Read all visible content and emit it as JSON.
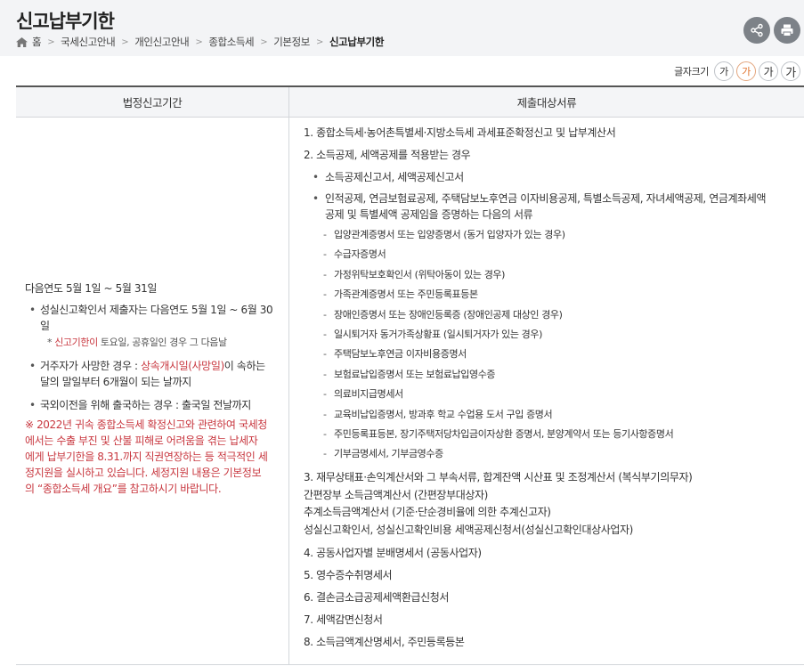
{
  "header": {
    "title": "신고납부기한",
    "breadcrumb": [
      "홈",
      "국세신고안내",
      "개인신고안내",
      "종합소득세",
      "기본정보",
      "신고납부기한"
    ]
  },
  "font_size": {
    "label": "글자크기",
    "options": [
      "가",
      "가",
      "가",
      "가"
    ]
  },
  "table": {
    "headers": [
      "법정신고기간",
      "제출대상서류"
    ],
    "left": {
      "period": "다음연도 5월 1일 ~ 5월 31일",
      "b1_line1": "성실신고확인서 제출자는 다음연도 5월 1일 ~ 6월 30",
      "b1_line2": "일",
      "note_prefix": "* ",
      "note_red": "신고기한이",
      "note_rest": " 토요일, 공휴일인 경우 그 다음날",
      "b2_pre": "거주자가 사망한 경우 : ",
      "b2_red": "상속개시일(사망일)",
      "b2_post_line1": "이 속하는",
      "b2_line2": "달의 말일부터 6개월이 되는 날까지",
      "b3": "국외이전을 위해 출국하는 경우 : 출국일 전날까지",
      "notice": [
        "※ 2022년 귀속 종합소득세 확정신고와 관련하여 국세청",
        "에서는 수출 부진 및 산불 피해로 어려움을 겪는 납세자",
        "에게 납부기한을 8.31.까지 직권연장하는 등 적극적인 세",
        "정지원을 실시하고 있습니다. 세정지원 내용은 기본정보",
        "의 “종합소득세 개요”를 참고하시기 바랍니다."
      ]
    },
    "right": {
      "item1": "1. 종합소득세·농어촌특별세·지방소득세 과세표준확정신고 및 납부계산서",
      "item2": "2. 소득공제, 세액공제를 적용받는 경우",
      "item2_b1": "소득공제신고서, 세액공제신고서",
      "item2_b2_line1": "인적공제, 연금보험료공제, 주택담보노후연금 이자비용공제, 특별소득공제, 자녀세액공제, 연금계좌세액",
      "item2_b2_line2": "공제 및 특별세액 공제임을 증명하는 다음의 서류",
      "dashes": [
        "입양관계증명서 또는 입양증명서 (동거 입양자가 있는 경우)",
        "수급자증명서",
        "가정위탁보호확인서 (위탁아동이 있는 경우)",
        "가족관계증명서 또는 주민등록표등본",
        "장애인증명서 또는 장애인등록증 (장애인공제 대상인 경우)",
        "일시퇴거자 동거가족상황표 (일시퇴거자가 있는 경우)",
        "주택담보노후연금 이자비용증명서",
        "보험료납입증명서 또는 보험료납입영수증",
        "의료비지급명세서",
        "교육비납입증명서, 방과후 학교 수업용 도서 구입 증명서",
        "주민등록표등본, 장기주택저당차입금이자상환 증명서, 분양계약서 또는 등기사항증명서",
        "기부금명세서, 기부금영수증"
      ],
      "item3": [
        "3. 재무상태표·손익계산서와 그 부속서류, 합계잔액 시산표 및 조정계산서 (복식부기의무자)",
        "간편장부 소득금액계산서 (간편장부대상자)",
        "추계소득금액계산서 (기준·단순경비율에 의한 추계신고자)",
        "성실신고확인서, 성실신고확인비용 세액공제신청서(성실신고확인대상사업자)"
      ],
      "items_rest": [
        "4. 공동사업자별 분배명세서 (공동사업자)",
        "5. 영수증수취명세서",
        "6. 결손금소급공제세액환급신청서",
        "7. 세액감면신청서",
        "8. 소득금액계산명세서, 주민등록등본"
      ]
    }
  },
  "colors": {
    "accent_red": "#c8373f",
    "active_font": "#e0712b",
    "button_gray": "#7d8288"
  }
}
